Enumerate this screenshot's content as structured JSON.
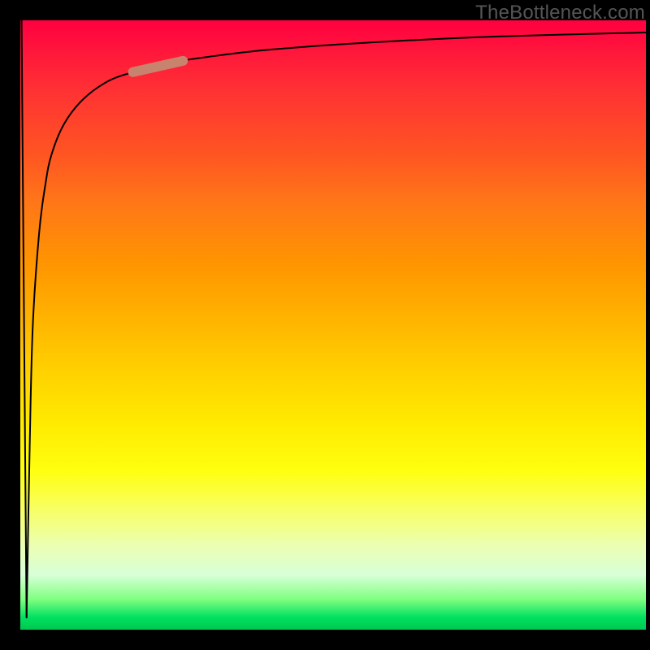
{
  "watermark": "TheBottleneck.com",
  "chart_data": {
    "type": "line",
    "title": "",
    "xlabel": "",
    "ylabel": "",
    "xlim": [
      0,
      100
    ],
    "ylim": [
      0,
      100
    ],
    "grid": false,
    "series": [
      {
        "name": "initial-dip",
        "x": [
          0.2,
          0.6,
          1.0
        ],
        "y": [
          100,
          50,
          2
        ]
      },
      {
        "name": "rise-curve",
        "x": [
          1.0,
          1.5,
          2,
          3,
          4,
          5,
          7,
          10,
          14,
          18,
          22,
          30,
          40,
          55,
          75,
          100
        ],
        "y": [
          2,
          30,
          50,
          65,
          73,
          78,
          83,
          87,
          90,
          91.5,
          92.7,
          94,
          95.2,
          96.3,
          97.3,
          98.0
        ]
      }
    ],
    "marker": {
      "approx_x_range": [
        18,
        26
      ],
      "approx_y_range": [
        91,
        93
      ],
      "color": "#c8836f"
    },
    "background_gradient": {
      "direction": "vertical",
      "stops": [
        {
          "pos": 0.0,
          "color": "#ff0040"
        },
        {
          "pos": 0.4,
          "color": "#ff9500"
        },
        {
          "pos": 0.74,
          "color": "#ffff10"
        },
        {
          "pos": 0.95,
          "color": "#80ff80"
        },
        {
          "pos": 1.0,
          "color": "#00c850"
        }
      ]
    }
  }
}
